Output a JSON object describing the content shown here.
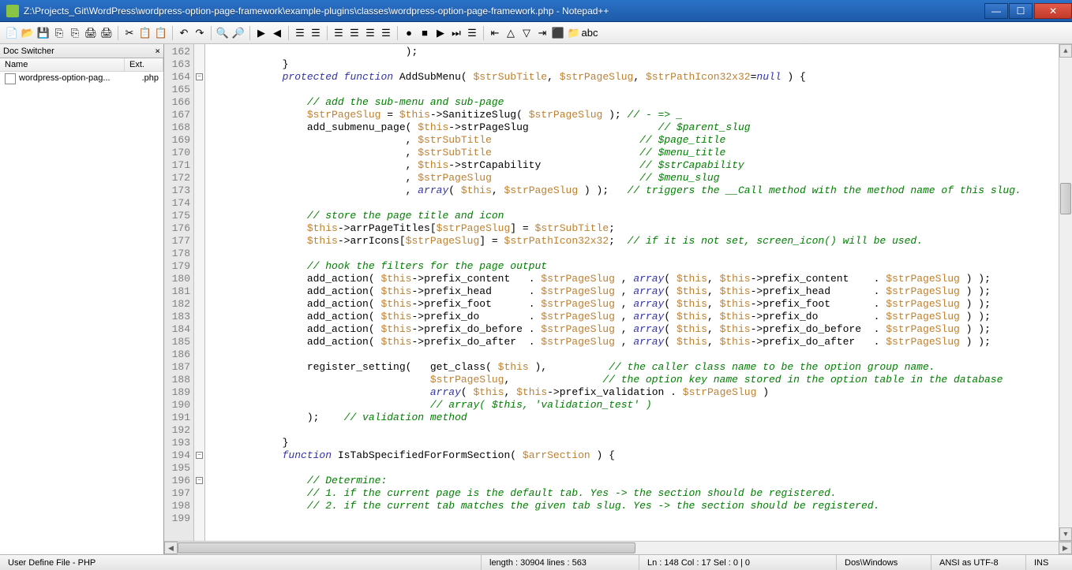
{
  "window": {
    "title": "Z:\\Projects_Git\\WordPress\\wordpress-option-page-framework\\example-plugins\\classes\\wordpress-option-page-framework.php - Notepad++"
  },
  "docswitcher": {
    "title": "Doc Switcher",
    "col_name": "Name",
    "col_ext": "Ext.",
    "item_name": "wordpress-option-pag...",
    "item_ext": ".php"
  },
  "gutter_lines": [
    "162",
    "163",
    "164",
    "165",
    "166",
    "167",
    "168",
    "169",
    "170",
    "171",
    "172",
    "173",
    "174",
    "175",
    "176",
    "177",
    "178",
    "179",
    "180",
    "181",
    "182",
    "183",
    "184",
    "185",
    "186",
    "187",
    "188",
    "189",
    "190",
    "191",
    "192",
    "193",
    "194",
    "195",
    "196",
    "197",
    "198",
    "199"
  ],
  "code_lines": [
    {
      "indent": "                                ",
      "segs": [
        {
          "t": ");",
          "c": "op"
        }
      ]
    },
    {
      "indent": "            ",
      "segs": [
        {
          "t": "}",
          "c": "op"
        }
      ]
    },
    {
      "indent": "            ",
      "segs": [
        {
          "t": "protected function",
          "c": "kw"
        },
        {
          "t": " AddSubMenu( ",
          "c": "fn"
        },
        {
          "t": "$strSubTitle",
          "c": "var"
        },
        {
          "t": ", ",
          "c": "op"
        },
        {
          "t": "$strPageSlug",
          "c": "var"
        },
        {
          "t": ", ",
          "c": "op"
        },
        {
          "t": "$strPathIcon32x32",
          "c": "var"
        },
        {
          "t": "=",
          "c": "op"
        },
        {
          "t": "null",
          "c": "nullkw"
        },
        {
          "t": " ) {",
          "c": "op"
        }
      ]
    },
    {
      "indent": "",
      "segs": []
    },
    {
      "indent": "                ",
      "segs": [
        {
          "t": "// add the sub-menu and sub-page",
          "c": "cm"
        }
      ]
    },
    {
      "indent": "                ",
      "segs": [
        {
          "t": "$strPageSlug",
          "c": "var"
        },
        {
          "t": " = ",
          "c": "op"
        },
        {
          "t": "$this",
          "c": "var"
        },
        {
          "t": "->SanitizeSlug( ",
          "c": "fn"
        },
        {
          "t": "$strPageSlug",
          "c": "var"
        },
        {
          "t": " ); ",
          "c": "op"
        },
        {
          "t": "// - => _",
          "c": "cm"
        }
      ]
    },
    {
      "indent": "                ",
      "segs": [
        {
          "t": "add_submenu_page( ",
          "c": "fn"
        },
        {
          "t": "$this",
          "c": "var"
        },
        {
          "t": "->strPageSlug                     ",
          "c": "fn"
        },
        {
          "t": "// $parent_slug",
          "c": "cm"
        }
      ]
    },
    {
      "indent": "                                ",
      "segs": [
        {
          "t": ", ",
          "c": "op"
        },
        {
          "t": "$strSubTitle",
          "c": "var"
        },
        {
          "t": "                        ",
          "c": "fn"
        },
        {
          "t": "// $page_title",
          "c": "cm"
        }
      ]
    },
    {
      "indent": "                                ",
      "segs": [
        {
          "t": ", ",
          "c": "op"
        },
        {
          "t": "$strSubTitle",
          "c": "var"
        },
        {
          "t": "                        ",
          "c": "fn"
        },
        {
          "t": "// $menu_title",
          "c": "cm"
        }
      ]
    },
    {
      "indent": "                                ",
      "segs": [
        {
          "t": ", ",
          "c": "op"
        },
        {
          "t": "$this",
          "c": "var"
        },
        {
          "t": "->strCapability                ",
          "c": "fn"
        },
        {
          "t": "// $strCapability",
          "c": "cm"
        }
      ]
    },
    {
      "indent": "                                ",
      "segs": [
        {
          "t": ", ",
          "c": "op"
        },
        {
          "t": "$strPageSlug",
          "c": "var"
        },
        {
          "t": "                        ",
          "c": "fn"
        },
        {
          "t": "// $menu_slug",
          "c": "cm"
        }
      ]
    },
    {
      "indent": "                                ",
      "segs": [
        {
          "t": ", ",
          "c": "op"
        },
        {
          "t": "array",
          "c": "kw"
        },
        {
          "t": "( ",
          "c": "op"
        },
        {
          "t": "$this",
          "c": "var"
        },
        {
          "t": ", ",
          "c": "op"
        },
        {
          "t": "$strPageSlug",
          "c": "var"
        },
        {
          "t": " ) );   ",
          "c": "op"
        },
        {
          "t": "// triggers the __Call method with the method name of this slug.",
          "c": "cm"
        }
      ]
    },
    {
      "indent": "",
      "segs": []
    },
    {
      "indent": "                ",
      "segs": [
        {
          "t": "// store the page title and icon",
          "c": "cm"
        }
      ]
    },
    {
      "indent": "                ",
      "segs": [
        {
          "t": "$this",
          "c": "var"
        },
        {
          "t": "->arrPageTitles[",
          "c": "fn"
        },
        {
          "t": "$strPageSlug",
          "c": "var"
        },
        {
          "t": "] = ",
          "c": "op"
        },
        {
          "t": "$strSubTitle",
          "c": "var"
        },
        {
          "t": ";",
          "c": "op"
        }
      ]
    },
    {
      "indent": "                ",
      "segs": [
        {
          "t": "$this",
          "c": "var"
        },
        {
          "t": "->arrIcons[",
          "c": "fn"
        },
        {
          "t": "$strPageSlug",
          "c": "var"
        },
        {
          "t": "] = ",
          "c": "op"
        },
        {
          "t": "$strPathIcon32x32",
          "c": "var"
        },
        {
          "t": ";  ",
          "c": "op"
        },
        {
          "t": "// if it is not set, screen_icon() will be used.",
          "c": "cm"
        }
      ]
    },
    {
      "indent": "",
      "segs": []
    },
    {
      "indent": "                ",
      "segs": [
        {
          "t": "// hook the filters for the page output",
          "c": "cm"
        }
      ]
    },
    {
      "indent": "                ",
      "segs": [
        {
          "t": "add_action( ",
          "c": "fn"
        },
        {
          "t": "$this",
          "c": "var"
        },
        {
          "t": "->prefix_content   . ",
          "c": "fn"
        },
        {
          "t": "$strPageSlug",
          "c": "var"
        },
        {
          "t": " , ",
          "c": "op"
        },
        {
          "t": "array",
          "c": "kw"
        },
        {
          "t": "( ",
          "c": "op"
        },
        {
          "t": "$this",
          "c": "var"
        },
        {
          "t": ", ",
          "c": "op"
        },
        {
          "t": "$this",
          "c": "var"
        },
        {
          "t": "->prefix_content    . ",
          "c": "fn"
        },
        {
          "t": "$strPageSlug",
          "c": "var"
        },
        {
          "t": " ) );",
          "c": "op"
        }
      ]
    },
    {
      "indent": "                ",
      "segs": [
        {
          "t": "add_action( ",
          "c": "fn"
        },
        {
          "t": "$this",
          "c": "var"
        },
        {
          "t": "->prefix_head      . ",
          "c": "fn"
        },
        {
          "t": "$strPageSlug",
          "c": "var"
        },
        {
          "t": " , ",
          "c": "op"
        },
        {
          "t": "array",
          "c": "kw"
        },
        {
          "t": "( ",
          "c": "op"
        },
        {
          "t": "$this",
          "c": "var"
        },
        {
          "t": ", ",
          "c": "op"
        },
        {
          "t": "$this",
          "c": "var"
        },
        {
          "t": "->prefix_head       . ",
          "c": "fn"
        },
        {
          "t": "$strPageSlug",
          "c": "var"
        },
        {
          "t": " ) );",
          "c": "op"
        }
      ]
    },
    {
      "indent": "                ",
      "segs": [
        {
          "t": "add_action( ",
          "c": "fn"
        },
        {
          "t": "$this",
          "c": "var"
        },
        {
          "t": "->prefix_foot      . ",
          "c": "fn"
        },
        {
          "t": "$strPageSlug",
          "c": "var"
        },
        {
          "t": " , ",
          "c": "op"
        },
        {
          "t": "array",
          "c": "kw"
        },
        {
          "t": "( ",
          "c": "op"
        },
        {
          "t": "$this",
          "c": "var"
        },
        {
          "t": ", ",
          "c": "op"
        },
        {
          "t": "$this",
          "c": "var"
        },
        {
          "t": "->prefix_foot       . ",
          "c": "fn"
        },
        {
          "t": "$strPageSlug",
          "c": "var"
        },
        {
          "t": " ) );",
          "c": "op"
        }
      ]
    },
    {
      "indent": "                ",
      "segs": [
        {
          "t": "add_action( ",
          "c": "fn"
        },
        {
          "t": "$this",
          "c": "var"
        },
        {
          "t": "->prefix_do        . ",
          "c": "fn"
        },
        {
          "t": "$strPageSlug",
          "c": "var"
        },
        {
          "t": " , ",
          "c": "op"
        },
        {
          "t": "array",
          "c": "kw"
        },
        {
          "t": "( ",
          "c": "op"
        },
        {
          "t": "$this",
          "c": "var"
        },
        {
          "t": ", ",
          "c": "op"
        },
        {
          "t": "$this",
          "c": "var"
        },
        {
          "t": "->prefix_do         . ",
          "c": "fn"
        },
        {
          "t": "$strPageSlug",
          "c": "var"
        },
        {
          "t": " ) );",
          "c": "op"
        }
      ]
    },
    {
      "indent": "                ",
      "segs": [
        {
          "t": "add_action( ",
          "c": "fn"
        },
        {
          "t": "$this",
          "c": "var"
        },
        {
          "t": "->prefix_do_before . ",
          "c": "fn"
        },
        {
          "t": "$strPageSlug",
          "c": "var"
        },
        {
          "t": " , ",
          "c": "op"
        },
        {
          "t": "array",
          "c": "kw"
        },
        {
          "t": "( ",
          "c": "op"
        },
        {
          "t": "$this",
          "c": "var"
        },
        {
          "t": ", ",
          "c": "op"
        },
        {
          "t": "$this",
          "c": "var"
        },
        {
          "t": "->prefix_do_before  . ",
          "c": "fn"
        },
        {
          "t": "$strPageSlug",
          "c": "var"
        },
        {
          "t": " ) );",
          "c": "op"
        }
      ]
    },
    {
      "indent": "                ",
      "segs": [
        {
          "t": "add_action( ",
          "c": "fn"
        },
        {
          "t": "$this",
          "c": "var"
        },
        {
          "t": "->prefix_do_after  . ",
          "c": "fn"
        },
        {
          "t": "$strPageSlug",
          "c": "var"
        },
        {
          "t": " , ",
          "c": "op"
        },
        {
          "t": "array",
          "c": "kw"
        },
        {
          "t": "( ",
          "c": "op"
        },
        {
          "t": "$this",
          "c": "var"
        },
        {
          "t": ", ",
          "c": "op"
        },
        {
          "t": "$this",
          "c": "var"
        },
        {
          "t": "->prefix_do_after   . ",
          "c": "fn"
        },
        {
          "t": "$strPageSlug",
          "c": "var"
        },
        {
          "t": " ) );",
          "c": "op"
        }
      ]
    },
    {
      "indent": "",
      "segs": []
    },
    {
      "indent": "                ",
      "segs": [
        {
          "t": "register_setting(   get_class( ",
          "c": "fn"
        },
        {
          "t": "$this",
          "c": "var"
        },
        {
          "t": " ),          ",
          "c": "op"
        },
        {
          "t": "// the caller class name to be the option group name.",
          "c": "cm"
        }
      ]
    },
    {
      "indent": "                                    ",
      "segs": [
        {
          "t": "$strPageSlug",
          "c": "var"
        },
        {
          "t": ",               ",
          "c": "op"
        },
        {
          "t": "// the option key name stored in the option table in the database",
          "c": "cm"
        }
      ]
    },
    {
      "indent": "                                    ",
      "segs": [
        {
          "t": "array",
          "c": "kw"
        },
        {
          "t": "( ",
          "c": "op"
        },
        {
          "t": "$this",
          "c": "var"
        },
        {
          "t": ", ",
          "c": "op"
        },
        {
          "t": "$this",
          "c": "var"
        },
        {
          "t": "->prefix_validation . ",
          "c": "fn"
        },
        {
          "t": "$strPageSlug",
          "c": "var"
        },
        {
          "t": " )",
          "c": "op"
        }
      ]
    },
    {
      "indent": "                                    ",
      "segs": [
        {
          "t": "// array( $this, 'validation_test' )",
          "c": "cm"
        }
      ]
    },
    {
      "indent": "                ",
      "segs": [
        {
          "t": ");    ",
          "c": "op"
        },
        {
          "t": "// validation method",
          "c": "cm"
        }
      ]
    },
    {
      "indent": "",
      "segs": []
    },
    {
      "indent": "            ",
      "segs": [
        {
          "t": "}",
          "c": "op"
        }
      ]
    },
    {
      "indent": "            ",
      "segs": [
        {
          "t": "function",
          "c": "kw"
        },
        {
          "t": " IsTabSpecifiedForFormSection( ",
          "c": "fn"
        },
        {
          "t": "$arrSection",
          "c": "var"
        },
        {
          "t": " ) {",
          "c": "op"
        }
      ]
    },
    {
      "indent": "",
      "segs": []
    },
    {
      "indent": "                ",
      "segs": [
        {
          "t": "// Determine:",
          "c": "cm"
        }
      ]
    },
    {
      "indent": "                ",
      "segs": [
        {
          "t": "// 1. if the current page is the default tab. Yes -> the section should be registered.",
          "c": "cm"
        }
      ]
    },
    {
      "indent": "                ",
      "segs": [
        {
          "t": "// 2. if the current tab matches the given tab slug. Yes -> the section should be registered.",
          "c": "cm"
        }
      ]
    },
    {
      "indent": "",
      "segs": []
    }
  ],
  "fold_markers": [
    {
      "line": 164,
      "sym": "−"
    },
    {
      "line": 194,
      "sym": "−"
    },
    {
      "line": 196,
      "sym": "−"
    }
  ],
  "status": {
    "filetype": "User Define File - PHP",
    "length": "length : 30904    lines : 563",
    "pos": "Ln : 148    Col : 17    Sel : 0 | 0",
    "eol": "Dos\\Windows",
    "enc": "ANSI as UTF-8",
    "ins": "INS"
  },
  "toolbar_icons": [
    "📄",
    "📂",
    "💾",
    "⎘",
    "⎘",
    "🖨",
    "🖨",
    " | ",
    "✂",
    "📋",
    "📋",
    " | ",
    "↶",
    "↷",
    " | ",
    "🔍",
    "🔎",
    " | ",
    "▶",
    "◀",
    " | ",
    "☰",
    "☰",
    " | ",
    "☰",
    "☰",
    "☰",
    "☰",
    " | ",
    "●",
    "■",
    "▶",
    "⏭",
    "☰",
    " | ",
    "⇤",
    "△",
    "▽",
    "⇥",
    "⬛",
    "📁",
    "abc"
  ]
}
